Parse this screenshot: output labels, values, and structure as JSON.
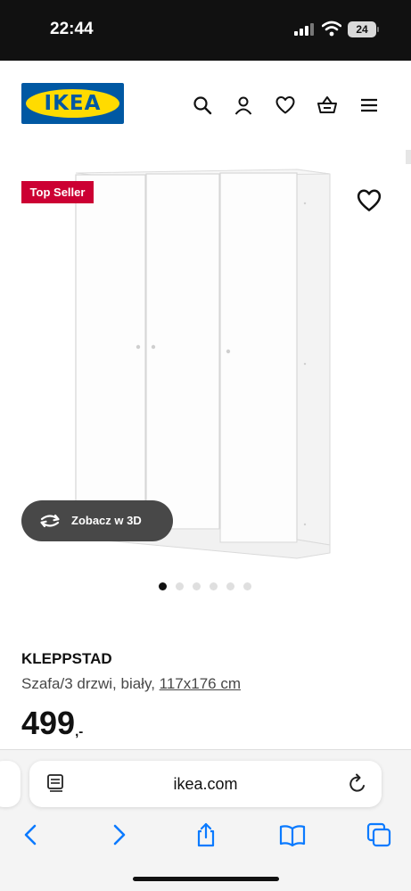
{
  "status_bar": {
    "time": "22:44",
    "battery_level": "24"
  },
  "header": {
    "logo_text": "IKEA",
    "icons": [
      "search-icon",
      "account-icon",
      "heart-icon",
      "basket-icon",
      "menu-icon"
    ],
    "colors": {
      "brand_blue": "#0058a3",
      "brand_yellow": "#ffdb00"
    }
  },
  "product_image": {
    "badge": "Top Seller",
    "badge_color": "#cc0033",
    "view_3d_label": "Zobacz w 3D",
    "carousel": {
      "total": 6,
      "active_index": 0
    }
  },
  "product": {
    "name": "KLEPPSTAD",
    "description": "Szafa/3 drzwi, biały, ",
    "dimensions": "117x176 cm",
    "price": "499",
    "price_suffix": ",-"
  },
  "browser": {
    "url": "ikea.com",
    "toolbar": [
      "back-icon",
      "forward-icon",
      "share-icon",
      "bookmarks-icon",
      "tabs-icon"
    ],
    "accent": "#0a7aff"
  }
}
